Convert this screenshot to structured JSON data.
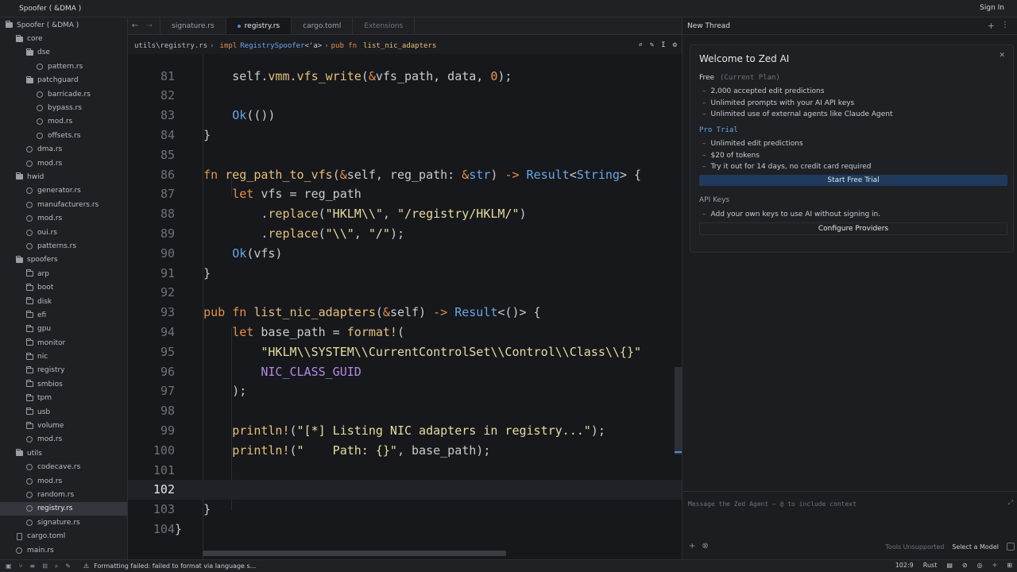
{
  "window": {
    "title": "Spoofer ( &DMA )",
    "sign_in": "Sign In"
  },
  "sidebar": {
    "items": [
      {
        "label": "Spoofer ( &DMA )",
        "depth": 0,
        "kind": "folder-open",
        "selected": false
      },
      {
        "label": "core",
        "depth": 1,
        "kind": "folder-open",
        "selected": false
      },
      {
        "label": "dse",
        "depth": 2,
        "kind": "folder-open",
        "selected": false
      },
      {
        "label": "pattern.rs",
        "depth": 3,
        "kind": "rs",
        "selected": false
      },
      {
        "label": "patchguard",
        "depth": 2,
        "kind": "folder-open",
        "selected": false
      },
      {
        "label": "barricade.rs",
        "depth": 3,
        "kind": "rs",
        "selected": false
      },
      {
        "label": "bypass.rs",
        "depth": 3,
        "kind": "rs",
        "selected": false
      },
      {
        "label": "mod.rs",
        "depth": 3,
        "kind": "rs",
        "selected": false
      },
      {
        "label": "offsets.rs",
        "depth": 3,
        "kind": "rs",
        "selected": false
      },
      {
        "label": "dma.rs",
        "depth": 2,
        "kind": "rs",
        "selected": false
      },
      {
        "label": "mod.rs",
        "depth": 2,
        "kind": "rs",
        "selected": false
      },
      {
        "label": "hwid",
        "depth": 1,
        "kind": "folder-open",
        "selected": false
      },
      {
        "label": "generator.rs",
        "depth": 2,
        "kind": "rs",
        "selected": false
      },
      {
        "label": "manufacturers.rs",
        "depth": 2,
        "kind": "rs",
        "selected": false
      },
      {
        "label": "mod.rs",
        "depth": 2,
        "kind": "rs",
        "selected": false
      },
      {
        "label": "oui.rs",
        "depth": 2,
        "kind": "rs",
        "selected": false
      },
      {
        "label": "patterns.rs",
        "depth": 2,
        "kind": "rs",
        "selected": false
      },
      {
        "label": "spoofers",
        "depth": 1,
        "kind": "folder-open",
        "selected": false
      },
      {
        "label": "arp",
        "depth": 2,
        "kind": "folder",
        "selected": false
      },
      {
        "label": "boot",
        "depth": 2,
        "kind": "folder",
        "selected": false
      },
      {
        "label": "disk",
        "depth": 2,
        "kind": "folder",
        "selected": false
      },
      {
        "label": "efi",
        "depth": 2,
        "kind": "folder",
        "selected": false
      },
      {
        "label": "gpu",
        "depth": 2,
        "kind": "folder",
        "selected": false
      },
      {
        "label": "monitor",
        "depth": 2,
        "kind": "folder",
        "selected": false
      },
      {
        "label": "nic",
        "depth": 2,
        "kind": "folder",
        "selected": false
      },
      {
        "label": "registry",
        "depth": 2,
        "kind": "folder",
        "selected": false
      },
      {
        "label": "smbios",
        "depth": 2,
        "kind": "folder",
        "selected": false
      },
      {
        "label": "tpm",
        "depth": 2,
        "kind": "folder",
        "selected": false
      },
      {
        "label": "usb",
        "depth": 2,
        "kind": "folder",
        "selected": false
      },
      {
        "label": "volume",
        "depth": 2,
        "kind": "folder",
        "selected": false
      },
      {
        "label": "mod.rs",
        "depth": 2,
        "kind": "rs",
        "selected": false
      },
      {
        "label": "utils",
        "depth": 1,
        "kind": "folder-open",
        "selected": false
      },
      {
        "label": "codecave.rs",
        "depth": 2,
        "kind": "rs",
        "selected": false
      },
      {
        "label": "mod.rs",
        "depth": 2,
        "kind": "rs",
        "selected": false
      },
      {
        "label": "random.rs",
        "depth": 2,
        "kind": "rs",
        "selected": false
      },
      {
        "label": "registry.rs",
        "depth": 2,
        "kind": "rs",
        "selected": true
      },
      {
        "label": "signature.rs",
        "depth": 2,
        "kind": "rs",
        "selected": false
      },
      {
        "label": "cargo.toml",
        "depth": 1,
        "kind": "file",
        "selected": false
      },
      {
        "label": "main.rs",
        "depth": 1,
        "kind": "rs",
        "selected": false
      }
    ]
  },
  "tabs": [
    {
      "label": "signature.rs",
      "active": false,
      "muted": false
    },
    {
      "label": "registry.rs",
      "active": true,
      "muted": false
    },
    {
      "label": "cargo.toml",
      "active": false,
      "muted": false
    },
    {
      "label": "Extensions",
      "active": false,
      "muted": true
    }
  ],
  "breadcrumb": {
    "path": "utils\\registry.rs",
    "sep": "›",
    "impl_kw": "impl",
    "impl_type": "RegistrySpoofer",
    "impl_generic": "<'a>",
    "sep2": "›",
    "fn_kw": "pub fn",
    "fn_name": "list_nic_adapters"
  },
  "editor": {
    "current_line": 102,
    "lines": [
      {
        "n": 81,
        "tokens": [
          [
            "pun",
            "        self."
          ],
          [
            "fnn",
            "vmm"
          ],
          [
            "pun",
            "."
          ],
          [
            "fnn",
            "vfs_write"
          ],
          [
            "pun",
            "("
          ],
          [
            "amp",
            "&"
          ],
          [
            "pun",
            "vfs_path, data, "
          ],
          [
            "num",
            "0"
          ],
          [
            "pun",
            ");"
          ]
        ]
      },
      {
        "n": 82,
        "tokens": []
      },
      {
        "n": 83,
        "tokens": [
          [
            "pun",
            "        "
          ],
          [
            "ty",
            "Ok"
          ],
          [
            "pun",
            "(())"
          ]
        ]
      },
      {
        "n": 84,
        "tokens": [
          [
            "pun",
            "    }"
          ]
        ]
      },
      {
        "n": 85,
        "tokens": []
      },
      {
        "n": 86,
        "tokens": [
          [
            "pun",
            "    "
          ],
          [
            "kw",
            "fn "
          ],
          [
            "fnn",
            "reg_path_to_vfs"
          ],
          [
            "pun",
            "("
          ],
          [
            "amp",
            "&"
          ],
          [
            "pun",
            "self, reg_path: "
          ],
          [
            "amp",
            "&"
          ],
          [
            "ty",
            "str"
          ],
          [
            "pun",
            ") "
          ],
          [
            "kw",
            "->"
          ],
          [
            "pun",
            " "
          ],
          [
            "ty",
            "Result"
          ],
          [
            "pun",
            "<"
          ],
          [
            "ty",
            "String"
          ],
          [
            "pun",
            "> {"
          ]
        ]
      },
      {
        "n": 87,
        "tokens": [
          [
            "pun",
            "        "
          ],
          [
            "kw",
            "let "
          ],
          [
            "pun",
            "vfs = reg_path"
          ]
        ]
      },
      {
        "n": 88,
        "tokens": [
          [
            "pun",
            "            ."
          ],
          [
            "fnn",
            "replace"
          ],
          [
            "pun",
            "("
          ],
          [
            "str",
            "\"HKLM\\\\\""
          ],
          [
            "pun",
            ", "
          ],
          [
            "str",
            "\"/registry/HKLM/\""
          ],
          [
            "pun",
            ")"
          ]
        ]
      },
      {
        "n": 89,
        "tokens": [
          [
            "pun",
            "            ."
          ],
          [
            "fnn",
            "replace"
          ],
          [
            "pun",
            "("
          ],
          [
            "str",
            "\"\\\\\""
          ],
          [
            "pun",
            ", "
          ],
          [
            "str",
            "\"/\""
          ],
          [
            "pun",
            ");"
          ]
        ]
      },
      {
        "n": 90,
        "tokens": [
          [
            "pun",
            "        "
          ],
          [
            "ty",
            "Ok"
          ],
          [
            "pun",
            "(vfs)"
          ]
        ]
      },
      {
        "n": 91,
        "tokens": [
          [
            "pun",
            "    }"
          ]
        ]
      },
      {
        "n": 92,
        "tokens": []
      },
      {
        "n": 93,
        "tokens": [
          [
            "pun",
            "    "
          ],
          [
            "kw",
            "pub fn "
          ],
          [
            "fnn",
            "list_nic_adapters"
          ],
          [
            "pun",
            "("
          ],
          [
            "amp",
            "&"
          ],
          [
            "pun",
            "self) "
          ],
          [
            "kw",
            "->"
          ],
          [
            "pun",
            " "
          ],
          [
            "ty",
            "Result"
          ],
          [
            "pun",
            "<()> {"
          ]
        ]
      },
      {
        "n": 94,
        "tokens": [
          [
            "pun",
            "        "
          ],
          [
            "kw",
            "let "
          ],
          [
            "pun",
            "base_path = "
          ],
          [
            "mac",
            "format!"
          ],
          [
            "pun",
            "("
          ]
        ]
      },
      {
        "n": 95,
        "tokens": [
          [
            "pun",
            "            "
          ],
          [
            "str",
            "\"HKLM\\\\SYSTEM\\\\CurrentControlSet\\\\Control\\\\Class\\\\{}\""
          ]
        ]
      },
      {
        "n": 96,
        "tokens": [
          [
            "pun",
            "            "
          ],
          [
            "cst",
            "NIC_CLASS_GUID"
          ]
        ]
      },
      {
        "n": 97,
        "tokens": [
          [
            "pun",
            "        );"
          ]
        ]
      },
      {
        "n": 98,
        "tokens": []
      },
      {
        "n": 99,
        "tokens": [
          [
            "pun",
            "        "
          ],
          [
            "mac",
            "println!"
          ],
          [
            "pun",
            "("
          ],
          [
            "str",
            "\"[*] Listing NIC adapters in registry...\""
          ],
          [
            "pun",
            ");"
          ]
        ]
      },
      {
        "n": 100,
        "tokens": [
          [
            "pun",
            "        "
          ],
          [
            "mac",
            "println!"
          ],
          [
            "pun",
            "("
          ],
          [
            "str",
            "\"    Path: {}\""
          ],
          [
            "pun",
            ", base_path);"
          ]
        ]
      },
      {
        "n": 101,
        "tokens": []
      },
      {
        "n": 102,
        "tokens": []
      },
      {
        "n": 103,
        "tokens": [
          [
            "pun",
            "    }"
          ]
        ]
      },
      {
        "n": 104,
        "tokens": [
          [
            "pun",
            "}"
          ]
        ]
      }
    ]
  },
  "agent_panel": {
    "header": "New Thread",
    "title": "Welcome to Zed AI",
    "free_label": "Free",
    "free_sub": "(Current Plan)",
    "free_bullets": [
      "2,000 accepted edit predictions",
      "Unlimited prompts with your AI API keys",
      "Unlimited use of external agents like Claude Agent"
    ],
    "pro_label": "Pro Trial",
    "pro_bullets": [
      "Unlimited edit predictions",
      "$20 of tokens",
      "Try it out for 14 days, no credit card required"
    ],
    "trial_button": "Start Free Trial",
    "api_label": "API Keys",
    "api_bullets": [
      "Add your own keys to use AI without signing in."
    ],
    "configure_button": "Configure Providers",
    "message_placeholder": "Message the Zed Agent — @ to include context",
    "tools_unsupported": "Tools Unsupported",
    "select_model": "Select a Model"
  },
  "statusbar": {
    "message": "Formatting failed: failed to format via language s...",
    "cursor": "102:9",
    "language": "Rust"
  },
  "colors": {
    "accent": "#4a8fe0",
    "keyword": "#e58f4a",
    "type": "#6aa6e8",
    "string": "#e6dda0",
    "function": "#e6c07b",
    "constant": "#b48ae6"
  }
}
